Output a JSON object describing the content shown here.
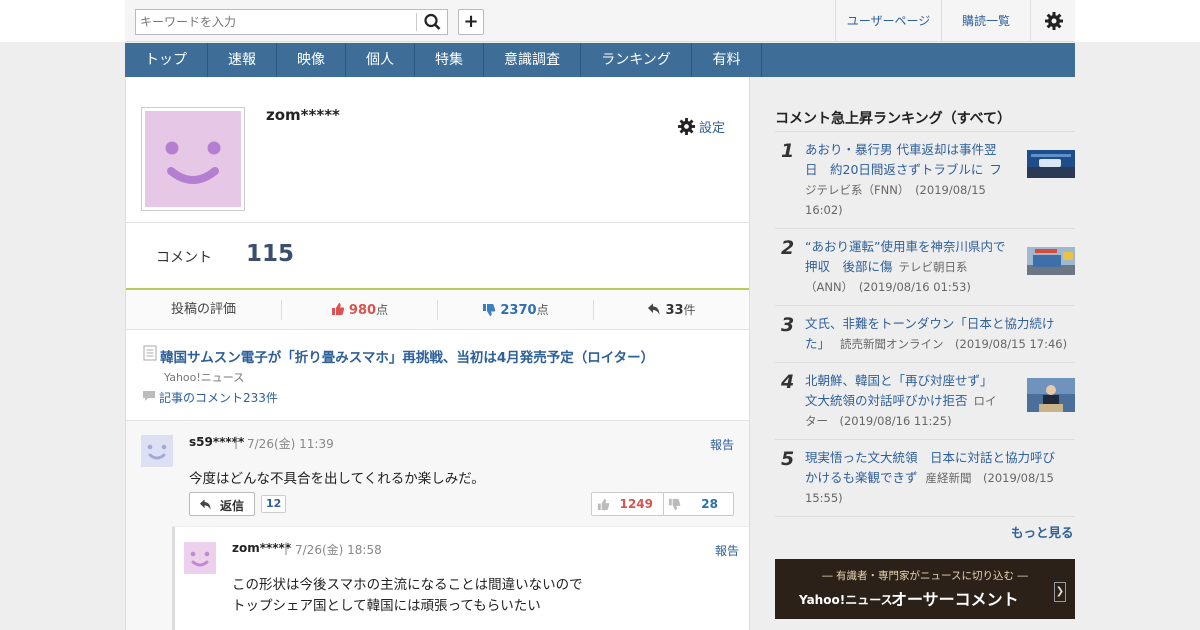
{
  "header": {
    "search_placeholder": "キーワードを入力",
    "user_page": "ユーザーページ",
    "subscriptions": "購読一覧"
  },
  "nav": [
    {
      "label": "トップ"
    },
    {
      "label": "速報"
    },
    {
      "label": "映像"
    },
    {
      "label": "個人"
    },
    {
      "label": "特集"
    },
    {
      "label": "意識調査"
    },
    {
      "label": "ランキング"
    },
    {
      "label": "有料"
    }
  ],
  "profile": {
    "username": "zom*****",
    "settings_label": "設定",
    "comment_label": "コメント",
    "comment_count": "115",
    "eval_label": "投稿の評価",
    "likes": "980",
    "likes_unit": "点",
    "dislikes": "2370",
    "dislikes_unit": "点",
    "replies": "33",
    "replies_unit": "件"
  },
  "article": {
    "title": "韓国サムスン電子が「折り畳みスマホ」再挑戦、当初は4月発売予定（ロイター）",
    "source": "Yahoo!ニュース",
    "comments_link": "記事のコメント233件"
  },
  "comment": {
    "user": "s59*****",
    "date": "7/26(金) 11:39",
    "report": "報告",
    "text": "今度はどんな不具合を出してくれるか楽しみだ。",
    "reply_label": "返信",
    "reply_count": "12",
    "likes": "1249",
    "dislikes": "28"
  },
  "reply": {
    "user": "zom*****",
    "date": "7/26(金) 18:58",
    "report": "報告",
    "line1": "この形状は今後スマホの主流になることは間違いないので",
    "line2": "トップシェア国として韓国には頑張ってもらいたい"
  },
  "sidebar": {
    "title": "コメント急上昇ランキング（すべて）",
    "items": [
      {
        "rank": "1",
        "l1": "あおり・暴行男 代車返却は事件翌",
        "l2": "日　約20日間返さずトラブルに",
        "s2": "フ",
        "s3": "ジテレビ系（FNN）　(2019/08/15",
        "s4": "16:02)"
      },
      {
        "rank": "2",
        "l1": "“あおり運転”使用車を神奈川県内で",
        "l2": "押収　後部に傷",
        "s2": "テレビ朝日系",
        "s3": "（ANN）　(2019/08/16 01:53)"
      },
      {
        "rank": "3",
        "l1": "文氏、非難をトーンダウン「日本と協力続け",
        "l2": "た」",
        "s2": "読売新聞オンライン　(2019/08/15 17:46)"
      },
      {
        "rank": "4",
        "l1": "北朝鮮、韓国と「再び対座せず」",
        "l2": "文大統領の対話呼びかけ拒否",
        "s2": "ロイ",
        "s3": "ター　(2019/08/16 11:25)"
      },
      {
        "rank": "5",
        "l1": "現実悟った文大統領　日本に対話と協力呼び",
        "l2": "かけるも楽観できず",
        "s2": "産経新聞　(2019/08/15",
        "s3": "15:55)"
      }
    ],
    "more": "もっと見る",
    "banner_sub": "― 有識者・専門家がニュースに切り込む ―",
    "banner_brand": "Yahoo!ニュース",
    "banner_title": "オーサーコメント"
  }
}
